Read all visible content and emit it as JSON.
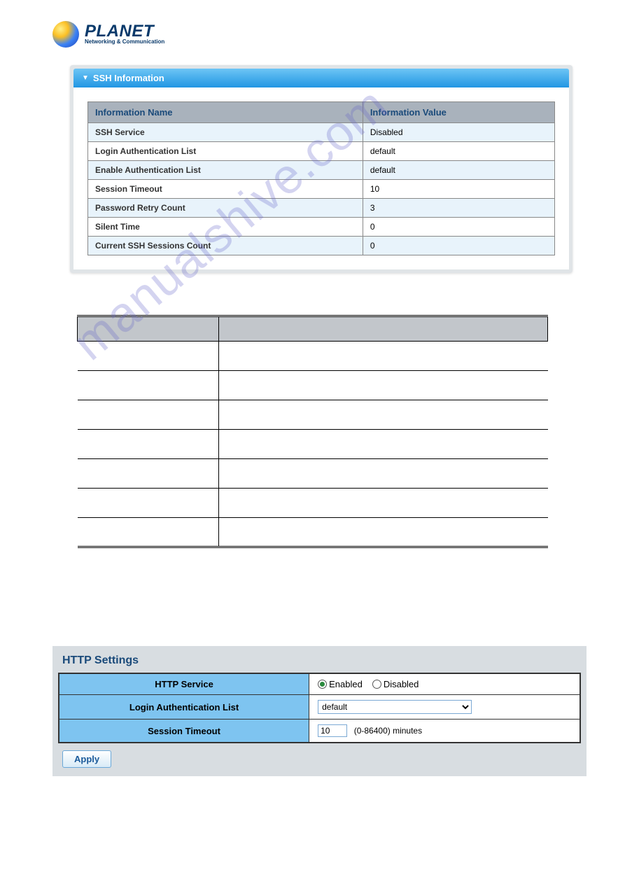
{
  "logo": {
    "main": "PLANET",
    "sub": "Networking & Communication"
  },
  "ssh_panel": {
    "title": "SSH Information",
    "col1": "Information Name",
    "col2": "Information Value",
    "rows": [
      {
        "name": "SSH Service",
        "value": "Disabled"
      },
      {
        "name": "Login Authentication List",
        "value": "default"
      },
      {
        "name": "Enable Authentication List",
        "value": "default"
      },
      {
        "name": "Session Timeout",
        "value": "10"
      },
      {
        "name": "Password Retry Count",
        "value": "3"
      },
      {
        "name": "Silent Time",
        "value": "0"
      },
      {
        "name": "Current SSH Sessions Count",
        "value": "0"
      }
    ]
  },
  "watermark": "manualshive.com",
  "http_panel": {
    "title": "HTTP Settings",
    "rows": {
      "service": {
        "label": "HTTP Service",
        "enabled": "Enabled",
        "disabled": "Disabled",
        "value": "enabled"
      },
      "login": {
        "label": "Login Authentication List",
        "value": "default"
      },
      "timeout": {
        "label": "Session Timeout",
        "value": "10",
        "hint": "(0-86400) minutes"
      }
    },
    "apply": "Apply"
  }
}
